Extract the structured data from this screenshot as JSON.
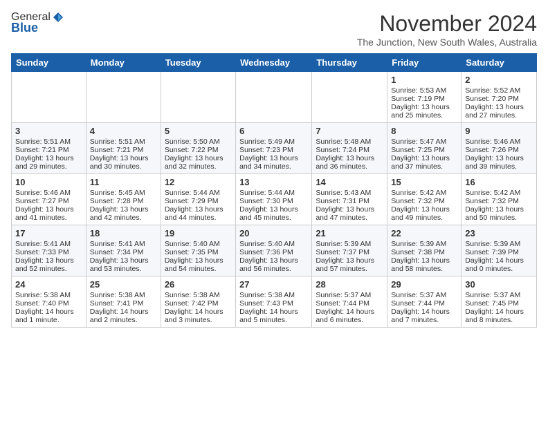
{
  "header": {
    "logo_general": "General",
    "logo_blue": "Blue",
    "month_title": "November 2024",
    "subtitle": "The Junction, New South Wales, Australia"
  },
  "days_of_week": [
    "Sunday",
    "Monday",
    "Tuesday",
    "Wednesday",
    "Thursday",
    "Friday",
    "Saturday"
  ],
  "weeks": [
    [
      {
        "day": "",
        "sunrise": "",
        "sunset": "",
        "daylight": ""
      },
      {
        "day": "",
        "sunrise": "",
        "sunset": "",
        "daylight": ""
      },
      {
        "day": "",
        "sunrise": "",
        "sunset": "",
        "daylight": ""
      },
      {
        "day": "",
        "sunrise": "",
        "sunset": "",
        "daylight": ""
      },
      {
        "day": "",
        "sunrise": "",
        "sunset": "",
        "daylight": ""
      },
      {
        "day": "1",
        "sunrise": "Sunrise: 5:53 AM",
        "sunset": "Sunset: 7:19 PM",
        "daylight": "Daylight: 13 hours and 25 minutes."
      },
      {
        "day": "2",
        "sunrise": "Sunrise: 5:52 AM",
        "sunset": "Sunset: 7:20 PM",
        "daylight": "Daylight: 13 hours and 27 minutes."
      }
    ],
    [
      {
        "day": "3",
        "sunrise": "Sunrise: 5:51 AM",
        "sunset": "Sunset: 7:21 PM",
        "daylight": "Daylight: 13 hours and 29 minutes."
      },
      {
        "day": "4",
        "sunrise": "Sunrise: 5:51 AM",
        "sunset": "Sunset: 7:21 PM",
        "daylight": "Daylight: 13 hours and 30 minutes."
      },
      {
        "day": "5",
        "sunrise": "Sunrise: 5:50 AM",
        "sunset": "Sunset: 7:22 PM",
        "daylight": "Daylight: 13 hours and 32 minutes."
      },
      {
        "day": "6",
        "sunrise": "Sunrise: 5:49 AM",
        "sunset": "Sunset: 7:23 PM",
        "daylight": "Daylight: 13 hours and 34 minutes."
      },
      {
        "day": "7",
        "sunrise": "Sunrise: 5:48 AM",
        "sunset": "Sunset: 7:24 PM",
        "daylight": "Daylight: 13 hours and 36 minutes."
      },
      {
        "day": "8",
        "sunrise": "Sunrise: 5:47 AM",
        "sunset": "Sunset: 7:25 PM",
        "daylight": "Daylight: 13 hours and 37 minutes."
      },
      {
        "day": "9",
        "sunrise": "Sunrise: 5:46 AM",
        "sunset": "Sunset: 7:26 PM",
        "daylight": "Daylight: 13 hours and 39 minutes."
      }
    ],
    [
      {
        "day": "10",
        "sunrise": "Sunrise: 5:46 AM",
        "sunset": "Sunset: 7:27 PM",
        "daylight": "Daylight: 13 hours and 41 minutes."
      },
      {
        "day": "11",
        "sunrise": "Sunrise: 5:45 AM",
        "sunset": "Sunset: 7:28 PM",
        "daylight": "Daylight: 13 hours and 42 minutes."
      },
      {
        "day": "12",
        "sunrise": "Sunrise: 5:44 AM",
        "sunset": "Sunset: 7:29 PM",
        "daylight": "Daylight: 13 hours and 44 minutes."
      },
      {
        "day": "13",
        "sunrise": "Sunrise: 5:44 AM",
        "sunset": "Sunset: 7:30 PM",
        "daylight": "Daylight: 13 hours and 45 minutes."
      },
      {
        "day": "14",
        "sunrise": "Sunrise: 5:43 AM",
        "sunset": "Sunset: 7:31 PM",
        "daylight": "Daylight: 13 hours and 47 minutes."
      },
      {
        "day": "15",
        "sunrise": "Sunrise: 5:42 AM",
        "sunset": "Sunset: 7:32 PM",
        "daylight": "Daylight: 13 hours and 49 minutes."
      },
      {
        "day": "16",
        "sunrise": "Sunrise: 5:42 AM",
        "sunset": "Sunset: 7:32 PM",
        "daylight": "Daylight: 13 hours and 50 minutes."
      }
    ],
    [
      {
        "day": "17",
        "sunrise": "Sunrise: 5:41 AM",
        "sunset": "Sunset: 7:33 PM",
        "daylight": "Daylight: 13 hours and 52 minutes."
      },
      {
        "day": "18",
        "sunrise": "Sunrise: 5:41 AM",
        "sunset": "Sunset: 7:34 PM",
        "daylight": "Daylight: 13 hours and 53 minutes."
      },
      {
        "day": "19",
        "sunrise": "Sunrise: 5:40 AM",
        "sunset": "Sunset: 7:35 PM",
        "daylight": "Daylight: 13 hours and 54 minutes."
      },
      {
        "day": "20",
        "sunrise": "Sunrise: 5:40 AM",
        "sunset": "Sunset: 7:36 PM",
        "daylight": "Daylight: 13 hours and 56 minutes."
      },
      {
        "day": "21",
        "sunrise": "Sunrise: 5:39 AM",
        "sunset": "Sunset: 7:37 PM",
        "daylight": "Daylight: 13 hours and 57 minutes."
      },
      {
        "day": "22",
        "sunrise": "Sunrise: 5:39 AM",
        "sunset": "Sunset: 7:38 PM",
        "daylight": "Daylight: 13 hours and 58 minutes."
      },
      {
        "day": "23",
        "sunrise": "Sunrise: 5:39 AM",
        "sunset": "Sunset: 7:39 PM",
        "daylight": "Daylight: 14 hours and 0 minutes."
      }
    ],
    [
      {
        "day": "24",
        "sunrise": "Sunrise: 5:38 AM",
        "sunset": "Sunset: 7:40 PM",
        "daylight": "Daylight: 14 hours and 1 minute."
      },
      {
        "day": "25",
        "sunrise": "Sunrise: 5:38 AM",
        "sunset": "Sunset: 7:41 PM",
        "daylight": "Daylight: 14 hours and 2 minutes."
      },
      {
        "day": "26",
        "sunrise": "Sunrise: 5:38 AM",
        "sunset": "Sunset: 7:42 PM",
        "daylight": "Daylight: 14 hours and 3 minutes."
      },
      {
        "day": "27",
        "sunrise": "Sunrise: 5:38 AM",
        "sunset": "Sunset: 7:43 PM",
        "daylight": "Daylight: 14 hours and 5 minutes."
      },
      {
        "day": "28",
        "sunrise": "Sunrise: 5:37 AM",
        "sunset": "Sunset: 7:44 PM",
        "daylight": "Daylight: 14 hours and 6 minutes."
      },
      {
        "day": "29",
        "sunrise": "Sunrise: 5:37 AM",
        "sunset": "Sunset: 7:44 PM",
        "daylight": "Daylight: 14 hours and 7 minutes."
      },
      {
        "day": "30",
        "sunrise": "Sunrise: 5:37 AM",
        "sunset": "Sunset: 7:45 PM",
        "daylight": "Daylight: 14 hours and 8 minutes."
      }
    ]
  ]
}
